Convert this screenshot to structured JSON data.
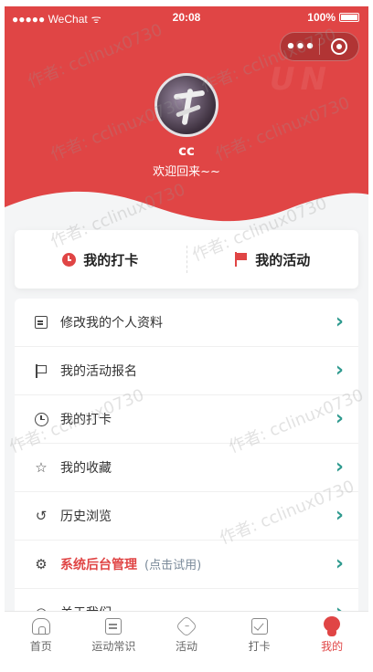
{
  "status_bar": {
    "carrier": "●●●●● WeChat",
    "time": "20:08",
    "battery": "100%"
  },
  "capsule": {
    "more_label": "•••"
  },
  "profile": {
    "name": "cc",
    "greeting": "欢迎回来~~"
  },
  "quick_actions": [
    {
      "label": "我的打卡",
      "icon": "clock-icon"
    },
    {
      "label": "我的活动",
      "icon": "flag-icon"
    }
  ],
  "menu": [
    {
      "label": "修改我的个人资料",
      "icon": "edit-icon"
    },
    {
      "label": "我的活动报名",
      "icon": "flag-icon"
    },
    {
      "label": "我的打卡",
      "icon": "clock-icon"
    },
    {
      "label": "我的收藏",
      "icon": "star-icon"
    },
    {
      "label": "历史浏览",
      "icon": "history-icon"
    },
    {
      "label": "系统后台管理",
      "hint": "(点击试用)",
      "icon": "gear-icon",
      "accent": "#e04545"
    },
    {
      "label": "关于我们",
      "icon": "info-icon"
    }
  ],
  "tabbar": [
    {
      "label": "首页",
      "icon": "home-icon"
    },
    {
      "label": "运动常识",
      "icon": "document-icon"
    },
    {
      "label": "活动",
      "icon": "activity-icon"
    },
    {
      "label": "打卡",
      "icon": "checkin-icon"
    },
    {
      "label": "我的",
      "icon": "profile-icon",
      "active": true
    }
  ],
  "watermark": "作者: cclinux0730",
  "colors": {
    "brand_red": "#e04545",
    "chevron_teal": "#2f9a8f",
    "background": "#f4f5f6"
  }
}
